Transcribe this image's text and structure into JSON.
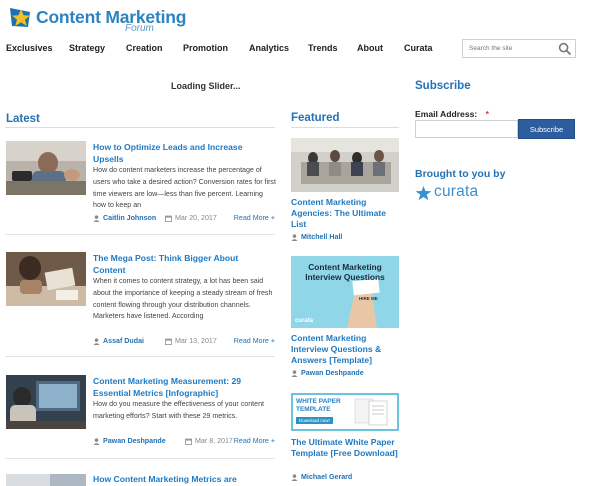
{
  "brand": {
    "title": "Content Marketing",
    "subtitle": "Forum"
  },
  "nav": [
    {
      "label": "Exclusives"
    },
    {
      "label": "Strategy"
    },
    {
      "label": "Creation"
    },
    {
      "label": "Promotion"
    },
    {
      "label": "Analytics"
    },
    {
      "label": "Trends"
    },
    {
      "label": "About"
    },
    {
      "label": "Curata"
    }
  ],
  "search": {
    "placeholder": "Search the site",
    "icon": "search-icon"
  },
  "slider": {
    "loading_text": "Loading Slider..."
  },
  "latest": {
    "heading": "Latest",
    "read_more_label": "Read More +",
    "posts": [
      {
        "title": "How to Optimize Leads and Increase Upsells",
        "excerpt": "How do content marketers increase the percentage of users who take a desired action? Conversion rates for first time viewers are low—less than five percent. Learning how to keep an",
        "author": "Caitlin Johnson",
        "date": "Mar 20, 2017"
      },
      {
        "title": "The Mega Post: Think Bigger About Content",
        "excerpt": "When it comes to content strategy, a lot has been said about the importance of keeping a steady stream of fresh content flowing through your distribution channels. Marketers have listened. According",
        "author": "Assaf Dudai",
        "date": "Mar 13, 2017"
      },
      {
        "title": "Content Marketing Measurement: 29 Essential Metrics [Infographic]",
        "excerpt": "How do you measure the effectiveness of your content marketing efforts? Start with these 29 metrics.",
        "author": "Pawan Deshpande",
        "date": "Mar 8, 2017"
      },
      {
        "title": "How Content Marketing Metrics are"
      }
    ]
  },
  "featured": {
    "heading": "Featured",
    "items": [
      {
        "title": "Content Marketing Agencies: The Ultimate List",
        "author": "Mitchell Hall"
      },
      {
        "title": "Content Marketing Interview Questions & Answers [Template]",
        "author": "Pawan Deshpande",
        "image_text": "Content Marketing Interview Questions",
        "image_sign": "HIRE ME",
        "image_brand": "curata"
      },
      {
        "title": "The Ultimate White Paper Template [Free Download]",
        "author": "Michael Gerard",
        "image_text": "WHITE PAPER TEMPLATE",
        "image_button": "Download now!"
      }
    ]
  },
  "sidebar": {
    "subscribe_heading": "Subscribe",
    "email_label": "Email Address:",
    "required_mark": "*",
    "subscribe_button": "Subscribe",
    "brought_by": "Brought to you by",
    "sponsor": "curata"
  },
  "colors": {
    "brand_blue": "#2572b4",
    "link_blue": "#1f7ac3",
    "button_navy": "#2e5d9f"
  }
}
